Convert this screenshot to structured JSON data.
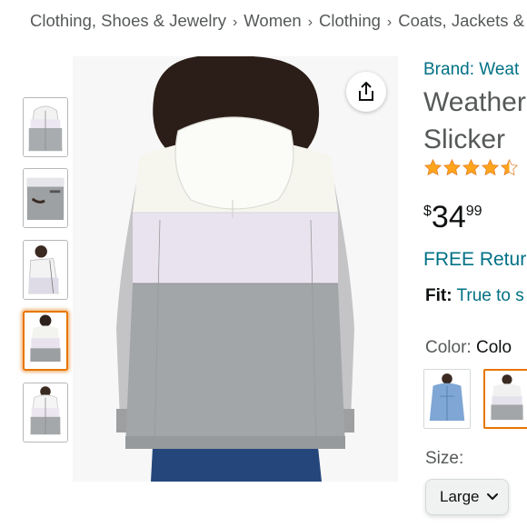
{
  "breadcrumb": [
    "Clothing, Shoes & Jewelry",
    "Women",
    "Clothing",
    "Coats, Jackets & V"
  ],
  "breadcrumb_separator": "›",
  "product": {
    "brand": "Brand: Weat",
    "title_lines": [
      "Weather",
      "Slicker"
    ],
    "rating": 4.5,
    "rating_max": 5,
    "price": {
      "symbol": "$",
      "whole": "34",
      "fraction": "99"
    },
    "free_returns": "FREE Retur",
    "fit": {
      "label": "Fit:",
      "value": "True to s"
    },
    "color": {
      "label": "Color:",
      "value": "Colo"
    },
    "size": {
      "label": "Size:",
      "selected": "Large"
    }
  },
  "thumbnails": [
    {
      "icon": "jacket-front-thumbnail"
    },
    {
      "icon": "jacket-pocket-thumbnail"
    },
    {
      "icon": "jacket-open-thumbnail"
    },
    {
      "icon": "jacket-back-thumbnail",
      "selected": true
    },
    {
      "icon": "jacket-front-model-thumbnail"
    }
  ],
  "colors": {
    "link": "#007185",
    "accent_orange": "#e77600",
    "star": "#ffa41c",
    "text": "#0f1111",
    "muted": "#565959"
  }
}
